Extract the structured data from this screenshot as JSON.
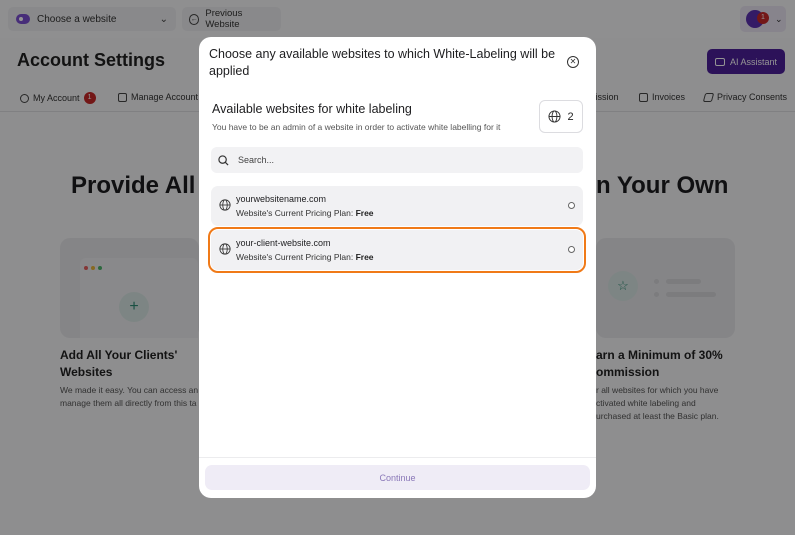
{
  "topbar": {
    "website_select_label": "Choose a website",
    "previous_label": "Previous Website",
    "avatar_badge": "1"
  },
  "page": {
    "title": "Account Settings",
    "ai_button": "AI Assistant",
    "tabs": [
      {
        "label": "My Account",
        "badge": "1"
      },
      {
        "label": "Manage Account"
      },
      {
        "label": "mission"
      },
      {
        "label": "Invoices"
      },
      {
        "label": "Privacy Consents"
      }
    ],
    "hero_left": "Provide All C",
    "hero_right": "n Your Own",
    "card_left": {
      "heading_line1": "Add All Your Clients'",
      "heading_line2": "Websites",
      "text_line1": "We made it easy. You can access an",
      "text_line2": "manage them all directly from this ta"
    },
    "card_right": {
      "heading_line1": "arn a Minimum of 30%",
      "heading_line2": "ommission",
      "text_line1": "r all websites for which you have",
      "text_line2": "ctivated white labeling and",
      "text_line3": "urchased at least the Basic plan."
    }
  },
  "modal": {
    "title": "Choose any available websites to which White-Labeling will be applied",
    "section_title": "Available websites for white labeling",
    "section_subtitle": "You have to be an admin of a website in order to activate white labelling for it",
    "count": "2",
    "search_placeholder": "Search...",
    "plan_prefix": "Website's Current Pricing Plan: ",
    "sites": [
      {
        "name": "yourwebsitename.com",
        "plan": "Free",
        "highlighted": false
      },
      {
        "name": "your-client-website.com",
        "plan": "Free",
        "highlighted": true
      }
    ],
    "continue_label": "Continue"
  },
  "colors": {
    "accent": "#4d1f9a",
    "highlight_border": "#f07a18",
    "badge": "#c62828",
    "teal": "#2e8b74"
  }
}
